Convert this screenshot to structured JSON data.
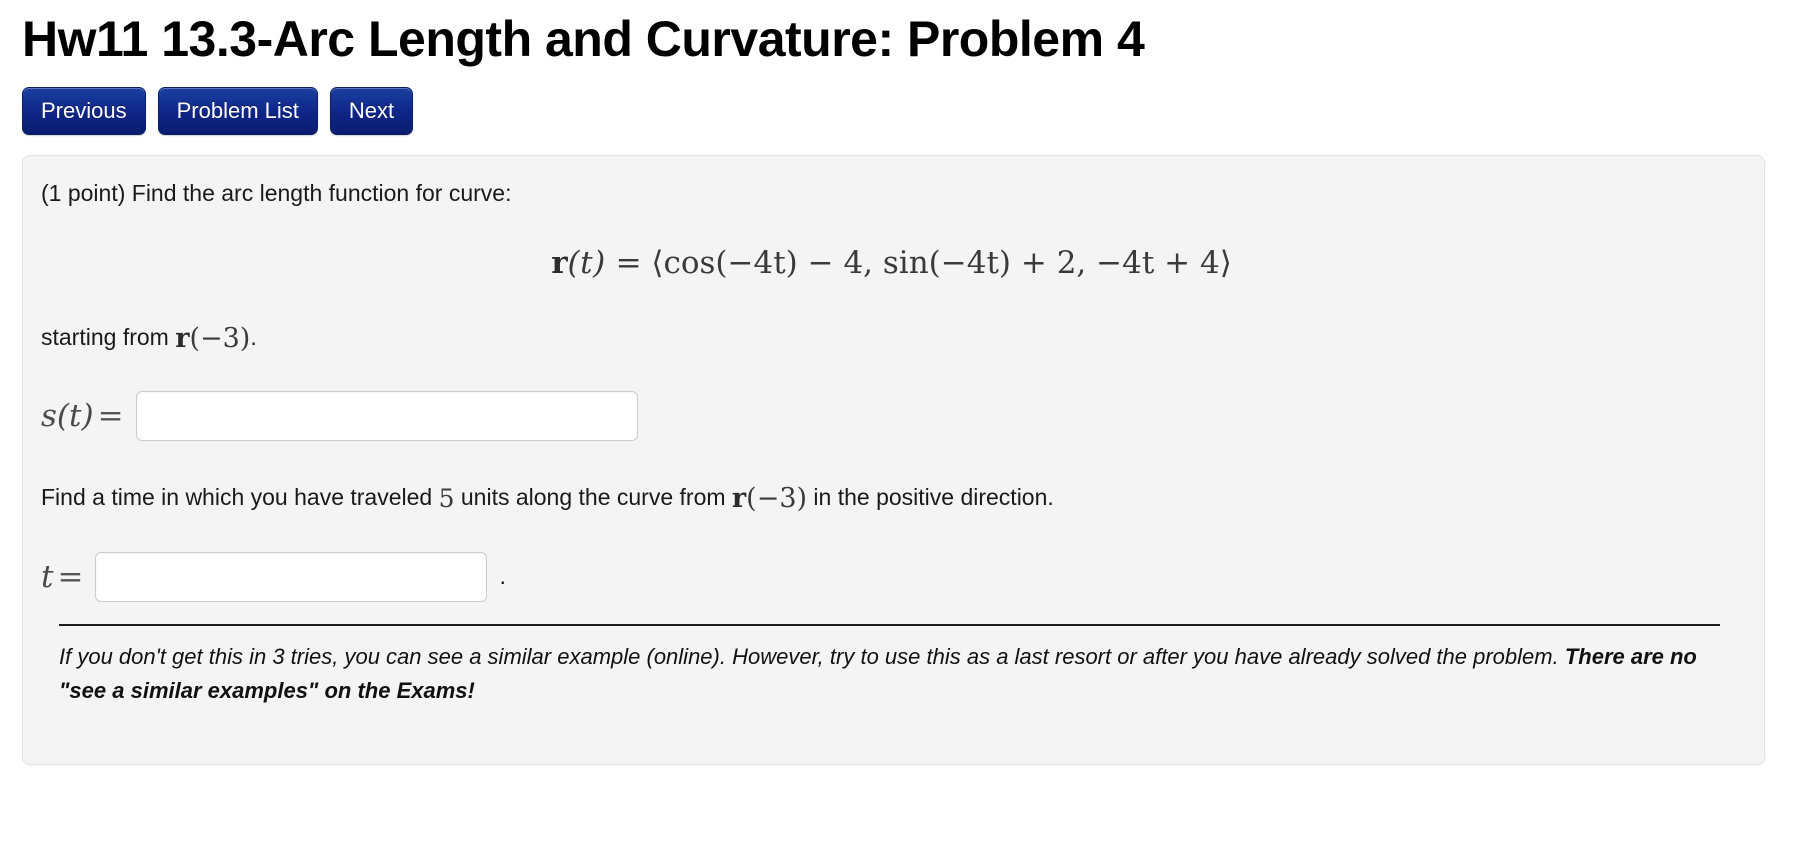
{
  "header": {
    "title": "Hw11 13.3-Arc Length and Curvature: Problem 4"
  },
  "nav": {
    "buttons": [
      {
        "label": "Previous",
        "name": "previous-button"
      },
      {
        "label": "Problem List",
        "name": "problem-list-button"
      },
      {
        "label": "Next",
        "name": "next-button"
      }
    ],
    "accent_color": "#11288a"
  },
  "problem": {
    "points_prompt": "(1 point) Find the arc length function for curve:",
    "vector_function": {
      "lhs_bold": "r",
      "lhs_arg": "(t)",
      "equals": "=",
      "rhs": "⟨cos(−4t) − 4, sin(−4t) + 2, −4t + 4⟩",
      "full_latex": "r(t) = ⟨cos(-4t) - 4, sin(-4t) + 2, -4t + 4⟩"
    },
    "starting_from_prefix": "starting from ",
    "starting_from_math_bold": "r",
    "starting_from_math_arg": "(−3)",
    "starting_from_suffix": ".",
    "s_label_fn": "s(t)",
    "s_label_eq": "=",
    "s_input_value": "",
    "s_input_placeholder": "",
    "question2_part1": "Find a time in which you have traveled ",
    "question2_amount": "5",
    "question2_part2": " units along the curve from ",
    "question2_math_bold": "r",
    "question2_math_arg": "(−3)",
    "question2_part3": " in the positive direction.",
    "t_label_fn": "t",
    "t_label_eq": "=",
    "t_input_value": "",
    "t_input_placeholder": "",
    "t_trailing_period": ".",
    "panel_bg": "#f4f4f4"
  },
  "footer": {
    "note_part1": "If you don't get this in 3 tries, you can see a similar example (online). However, try to use this as a last resort or after you have already solved the problem. ",
    "note_bold": "There are no \"see a similar examples\" on the Exams!"
  }
}
